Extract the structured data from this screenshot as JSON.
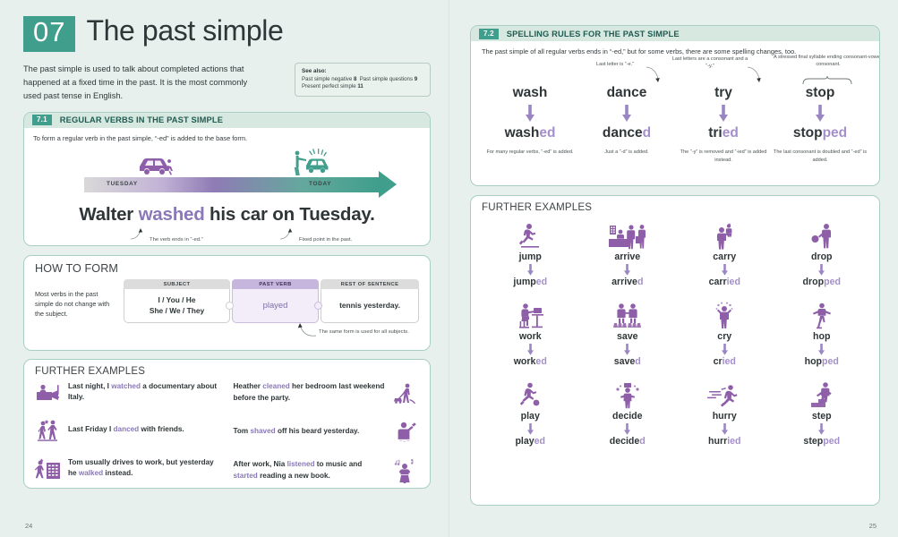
{
  "chapter": {
    "number": "07",
    "title": "The past simple"
  },
  "intro": "The past simple is used to talk about completed actions that happened at a fixed time in the past. It is the most commonly used past tense in English.",
  "see_also": {
    "title": "See also:",
    "lines": [
      {
        "text": "Past simple negative",
        "ref": "8",
        "text2": "Past simple questions",
        "ref2": "9"
      },
      {
        "text": "Present perfect simple",
        "ref": "11"
      }
    ]
  },
  "section_71": {
    "badge": "7.1",
    "heading": "REGULAR VERBS IN THE PAST SIMPLE",
    "rule": "To form a regular verb in the past simple, “-ed” is added to the base form.",
    "timeline": {
      "left_label": "TUESDAY",
      "right_label": "TODAY"
    },
    "sentence": {
      "before": "Walter ",
      "highlight": "washed",
      "after": " his car on Tuesday."
    },
    "note_left": "The verb ends in “-ed.”",
    "note_right": "Fixed point in the past."
  },
  "how_to_form": {
    "title": "HOW TO FORM",
    "note": "Most verbs in the past simple do not change with the subject.",
    "columns": [
      {
        "header": "SUBJECT",
        "line1": "I / You / He",
        "line2": "She / We / They"
      },
      {
        "header": "PAST VERB",
        "line1": "played"
      },
      {
        "header": "REST OF SENTENCE",
        "line1": "tennis yesterday."
      }
    ],
    "footnote": "The same form is used for all subjects."
  },
  "further_examples_left": {
    "title": "FURTHER EXAMPLES",
    "column1": [
      {
        "icon": "tv-watching-icon",
        "before": "Last night, I ",
        "highlight": "watched",
        "after": " a documentary about Italy."
      },
      {
        "icon": "dancing-couple-icon",
        "before": "Last Friday I ",
        "highlight": "danced",
        "after": " with friends."
      },
      {
        "icon": "walking-to-office-icon",
        "before": "Tom usually drives to work, but yesterday he ",
        "highlight": "walked",
        "after": " instead."
      }
    ],
    "column2": [
      {
        "icon": "vacuum-cleaning-icon",
        "before": "Heather ",
        "highlight": "cleaned",
        "after": " her bedroom last weekend before the party."
      },
      {
        "icon": "shaving-icon",
        "before": "Tom ",
        "highlight": "shaved",
        "after": " off his beard yesterday."
      },
      {
        "icon": "listening-music-icon",
        "before": "After work, Nia ",
        "highlight": "listened",
        "after": " to music and ",
        "highlight2": "started",
        "after2": " reading a new book."
      }
    ]
  },
  "section_72": {
    "badge": "7.2",
    "heading": "SPELLING RULES FOR THE PAST SIMPLE",
    "rule": "The past simple of all regular verbs ends in “-ed,” but for some verbs, there are some spelling changes, too.",
    "annotations": [
      {
        "text": "Last letter is “-e.”"
      },
      {
        "text": "Last letters are a consonant and a “-y.”"
      },
      {
        "text": "A stressed final syllable ending consonant-vowel-consonant."
      }
    ],
    "rules": [
      {
        "base": "wash",
        "stem": "wash",
        "suffix": "ed",
        "caption": "For many regular verbs, “-ed” is added."
      },
      {
        "base": "dance",
        "stem": "dance",
        "suffix": "d",
        "caption": "Just a “-d” is added."
      },
      {
        "base": "try",
        "stem": "tri",
        "suffix": "ed",
        "caption": "The “-y” is removed and “-ied” is added instead."
      },
      {
        "base": "stop",
        "stem": "stop",
        "suffix": "ped",
        "caption": "The last consonant is doubled and “-ed” is added."
      }
    ]
  },
  "further_examples_right": {
    "title": "FURTHER EXAMPLES",
    "rows": [
      [
        {
          "icon": "jumping-person-icon",
          "base": "jump",
          "stem": "jump",
          "suffix": "ed"
        },
        {
          "icon": "hotel-arrival-icon",
          "base": "arrive",
          "stem": "arrive",
          "suffix": "d"
        },
        {
          "icon": "carrying-child-icon",
          "base": "carry",
          "stem": "carr",
          "suffix": "ied"
        },
        {
          "icon": "dropping-ball-icon",
          "base": "drop",
          "stem": "drop",
          "suffix": "ped"
        }
      ],
      [
        {
          "icon": "desk-working-icon",
          "base": "work",
          "stem": "work",
          "suffix": "ed"
        },
        {
          "icon": "saving-money-icon",
          "base": "save",
          "stem": "save",
          "suffix": "d"
        },
        {
          "icon": "crying-person-icon",
          "base": "cry",
          "stem": "cr",
          "suffix": "ied"
        },
        {
          "icon": "hopping-person-icon",
          "base": "hop",
          "stem": "hop",
          "suffix": "ped"
        }
      ],
      [
        {
          "icon": "playing-football-icon",
          "base": "play",
          "stem": "play",
          "suffix": "ed"
        },
        {
          "icon": "deciding-person-icon",
          "base": "decide",
          "stem": "decide",
          "suffix": "d"
        },
        {
          "icon": "hurrying-person-icon",
          "base": "hurry",
          "stem": "hurr",
          "suffix": "ied"
        },
        {
          "icon": "stepping-up-icon",
          "base": "step",
          "stem": "step",
          "suffix": "ped"
        }
      ]
    ]
  },
  "page_numbers": {
    "left": "24",
    "right": "25"
  },
  "colors": {
    "teal": "#3f9e8c",
    "purple": "#8a78b8",
    "icon_purple": "#8e5fa8",
    "page_bg": "#e7f0ec"
  }
}
